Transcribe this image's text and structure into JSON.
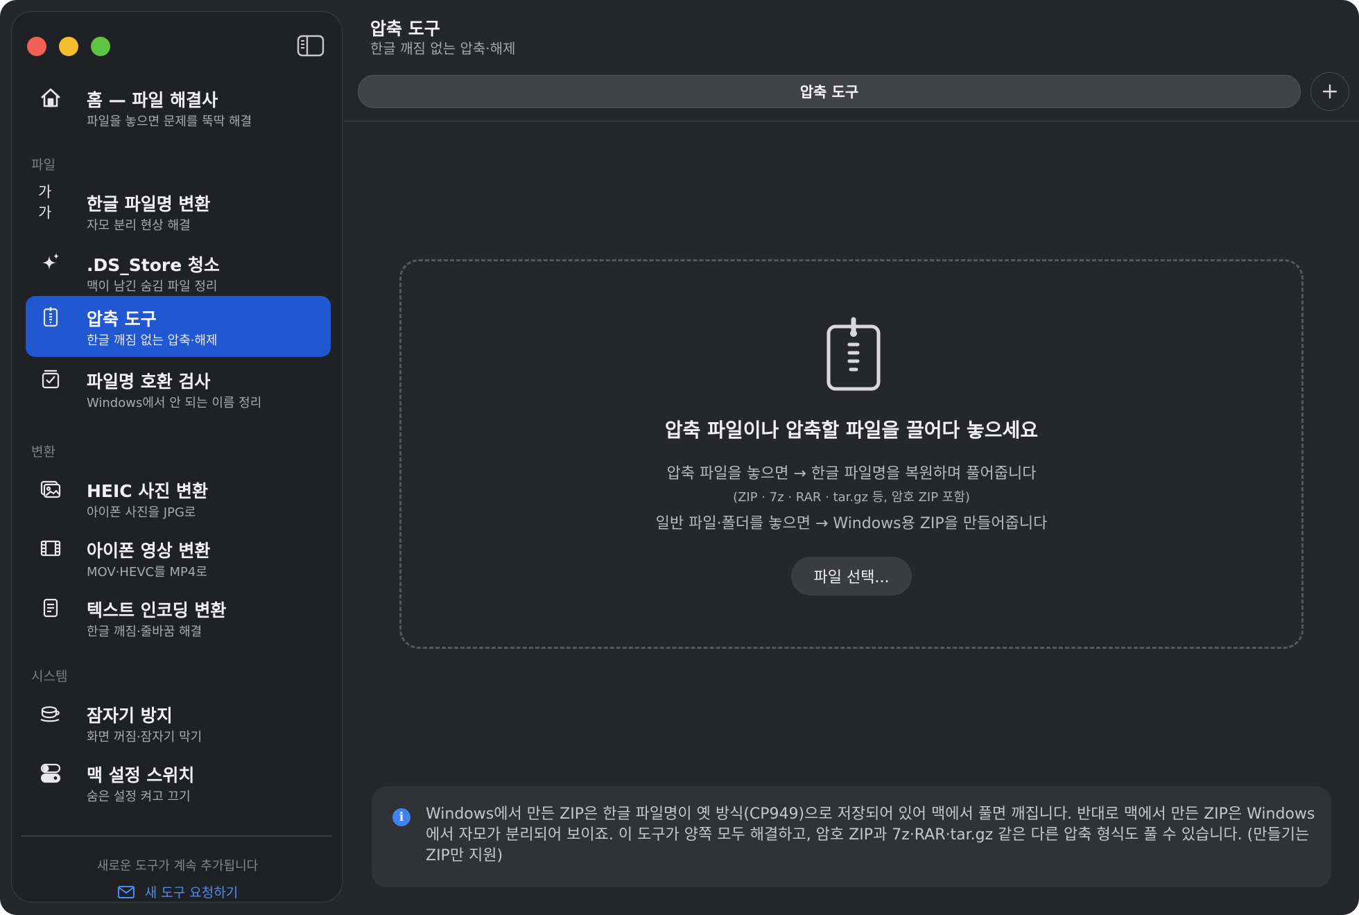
{
  "window": {
    "controls": {
      "close": "#ed5f57",
      "minimize": "#f5be2f",
      "maximize": "#5ec441"
    },
    "toggle_icon": "sidebar-toggle-icon"
  },
  "sidebar": {
    "home": {
      "title": "홈 — 파일 해결사",
      "subtitle": "파일을 놓으면 문제를 뚝딱 해결",
      "icon": "house-icon"
    },
    "sections": {
      "files": "파일",
      "convert": "변환",
      "system": "시스템"
    },
    "items": [
      {
        "title": "한글 파일명 변환",
        "subtitle": "자모 분리 현상 해결",
        "icon_text": "가가",
        "icon": "hangul-icon"
      },
      {
        "title": ".DS_Store 청소",
        "subtitle": "맥이 남긴 숨김 파일 정리",
        "icon": "sparkles-icon"
      },
      {
        "title": "압축 도구",
        "subtitle": "한글 깨짐 없는 압축·해제",
        "icon": "zip-doc-icon",
        "active": true
      },
      {
        "title": "파일명 호환 검사",
        "subtitle": "Windows에서 안 되는 이름 정리",
        "icon": "checklist-icon"
      },
      {
        "title": "HEIC 사진 변환",
        "subtitle": "아이폰 사진을 JPG로",
        "icon": "photos-icon"
      },
      {
        "title": "아이폰 영상 변환",
        "subtitle": "MOV·HEVC를 MP4로",
        "icon": "film-icon"
      },
      {
        "title": "텍스트 인코딩 변환",
        "subtitle": "한글 깨짐·줄바꿈 해결",
        "icon": "text-doc-icon"
      },
      {
        "title": "잠자기 방지",
        "subtitle": "화면 꺼짐·잠자기 막기",
        "icon": "coffee-cup-icon"
      },
      {
        "title": "맥 설정 스위치",
        "subtitle": "숨은 설정 켜고 끄기",
        "icon": "switches-icon"
      }
    ],
    "footer_note": "새로운 도구가 계속 추가됩니다",
    "request_link": "새 도구 요청하기",
    "accent": "#2257d2"
  },
  "main": {
    "title": "압축 도구",
    "subtitle": "한글 깨짐 없는 압축·해제",
    "tab": "압축 도구",
    "drop_zone": {
      "title": "압축 파일이나 압축할 파일을 끌어다 놓으세요",
      "line1": "압축 파일을 놓으면 → 한글 파일명을 복원하며 풀어줍니다",
      "line2": "(ZIP · 7z · RAR · tar.gz 등, 암호 ZIP 포함)",
      "line3": "일반 파일·폴더를 놓으면 → Windows용 ZIP을 만들어줍니다",
      "button": "파일 선택..."
    },
    "info": "Windows에서 만든 ZIP은 한글 파일명이 옛 방식(CP949)으로 저장되어 있어 맥에서 풀면 깨집니다. 반대로 맥에서 만든 ZIP은 Windows에서 자모가 분리되어 보이죠. 이 도구가 양쪽 모두 해결하고, 암호 ZIP과 7z·RAR·tar.gz 같은 다른 압축 형식도 풀 수 있습니다. (만들기는 ZIP만 지원)"
  }
}
